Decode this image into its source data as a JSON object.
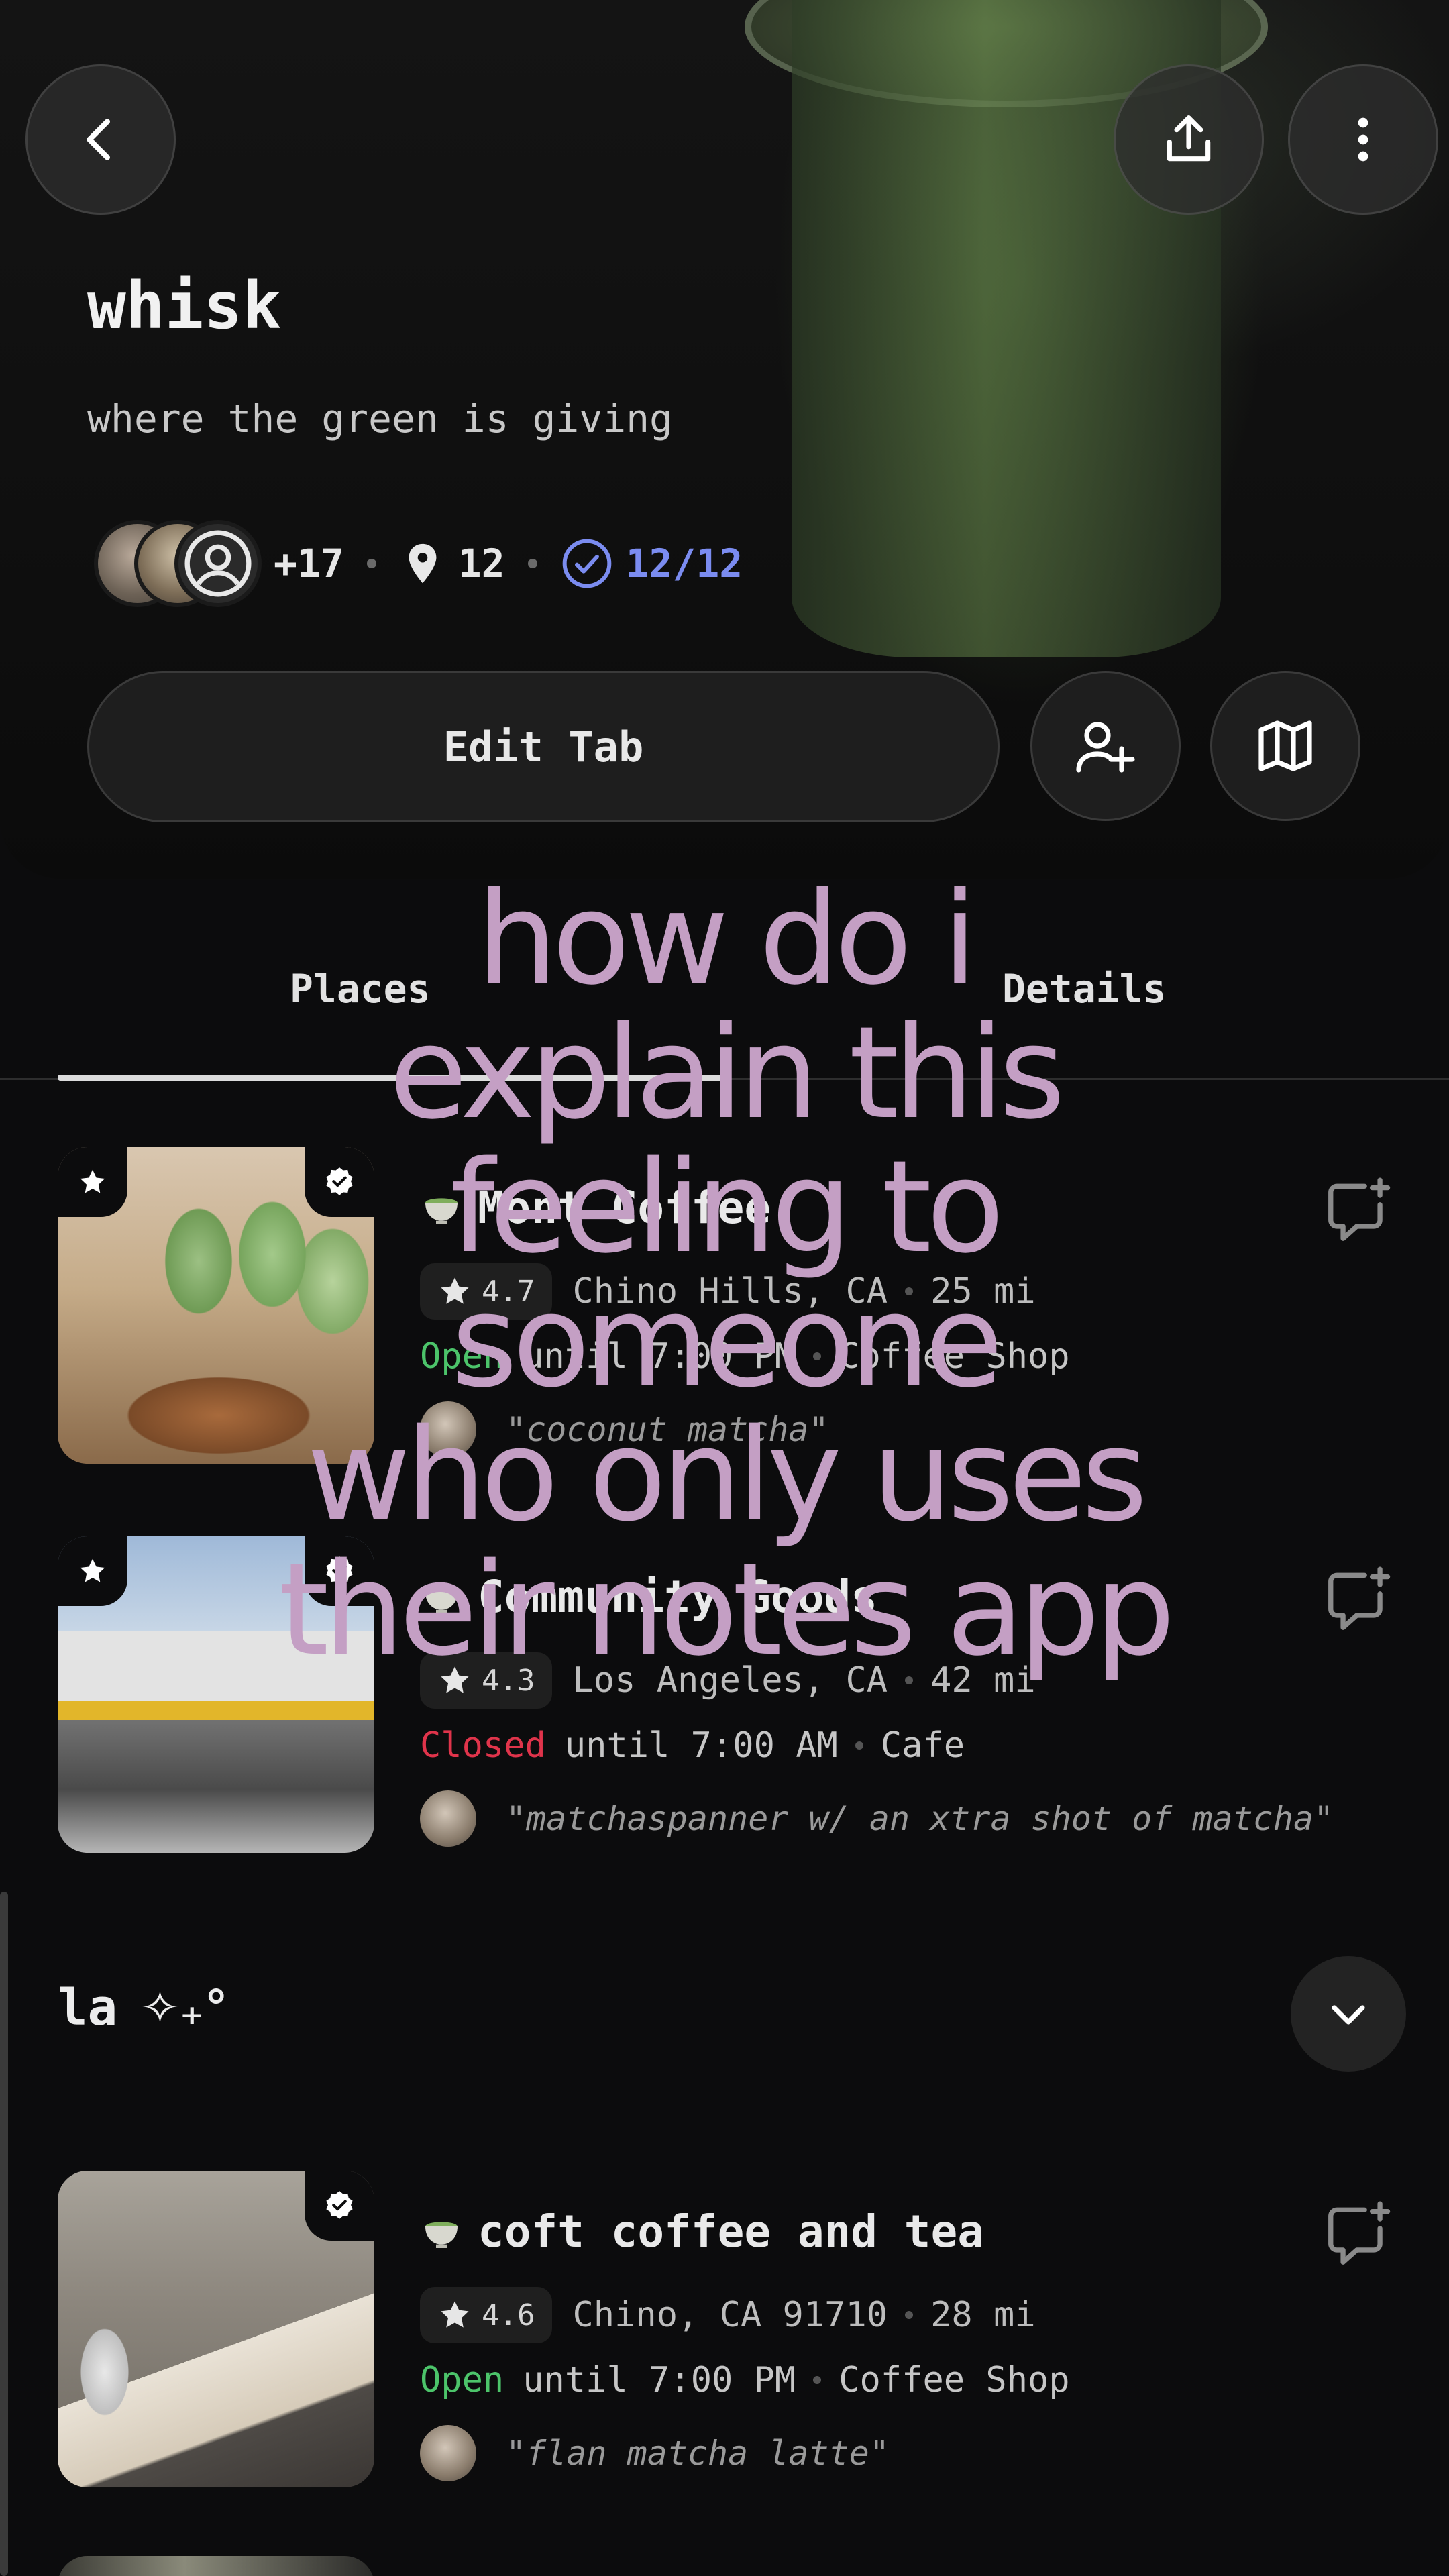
{
  "header": {
    "title": "whisk",
    "subtitle": "where the green is giving",
    "members_extra": "+17",
    "places_count": "12",
    "verified_count": "12/12",
    "edit_label": "Edit Tab"
  },
  "tabs": [
    {
      "label": "Places",
      "active": true
    },
    {
      "label": "Details",
      "active": false
    }
  ],
  "places": [
    {
      "name": "Mont Coffee",
      "rating": "4.7",
      "location": "Chino Hills, CA",
      "distance": "25 mi",
      "status": "Open",
      "hours": "until 7:00 PM",
      "category": "Coffee Shop",
      "note": "\"coconut matcha\""
    },
    {
      "name": "Community Goods",
      "rating": "4.3",
      "location": "Los Angeles, CA",
      "distance": "42 mi",
      "status": "Closed",
      "hours": "until 7:00 AM",
      "category": "Cafe",
      "note": "\"matchaspanner w/ an xtra shot of matcha\""
    }
  ],
  "section": {
    "title": "la",
    "title_decor": "✧₊°",
    "places": [
      {
        "name": "coft coffee and tea",
        "rating": "4.6",
        "location": "Chino, CA 91710",
        "distance": "28 mi",
        "status": "Open",
        "hours": "until 7:00 PM",
        "category": "Coffee Shop",
        "note": "\"flan matcha latte\""
      }
    ]
  },
  "overlay_caption": [
    "how do i",
    "explain this",
    "feeling to",
    "someone",
    "who only uses",
    "their notes app"
  ],
  "colors": {
    "open": "#4cc46a",
    "closed": "#e0344b",
    "verified": "#7b8cf0",
    "caption": "#c49fc4"
  }
}
